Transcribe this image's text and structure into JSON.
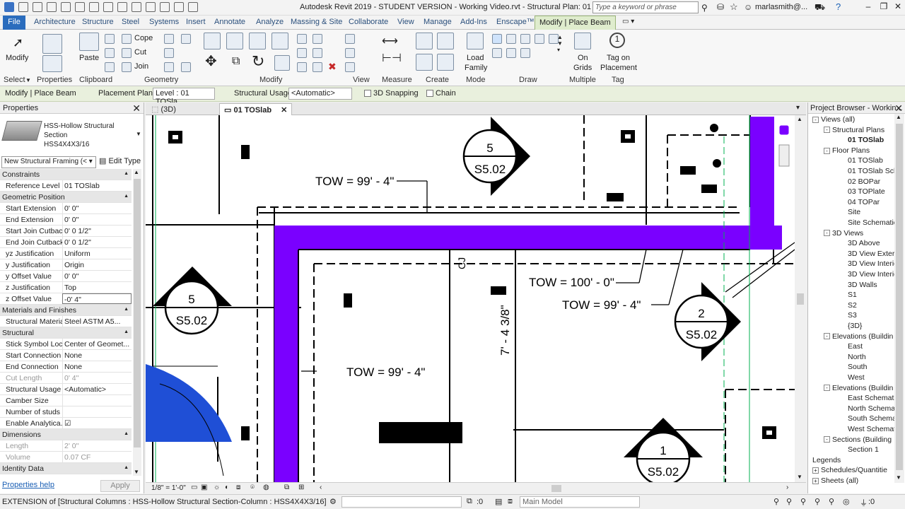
{
  "app": {
    "title": "Autodesk Revit 2019 - STUDENT VERSION - Working Video.rvt - Structural Plan: 01 TOSlab",
    "search_placeholder": "Type a keyword or phrase",
    "user": "marlasmith@..."
  },
  "tabs": [
    "File",
    "Architecture",
    "Structure",
    "Steel",
    "Systems",
    "Insert",
    "Annotate",
    "Analyze",
    "Massing & Site",
    "Collaborate",
    "View",
    "Manage",
    "Add-Ins",
    "Enscape™",
    "Modify | Place Beam"
  ],
  "ribbon": {
    "modify_label": "Modify",
    "paste_label": "Paste",
    "cope_label": "Cope",
    "cut_label": "Cut",
    "join_label": "Join",
    "load_family_l1": "Load",
    "load_family_l2": "Family",
    "on_grids_l1": "On",
    "on_grids_l2": "Grids",
    "tag_l1": "Tag on",
    "tag_l2": "Placement",
    "panels": [
      "Select",
      "Properties",
      "Clipboard",
      "Geometry",
      "Modify",
      "View",
      "Measure",
      "Create",
      "Mode",
      "Draw",
      "Multiple",
      "Tag"
    ]
  },
  "options": {
    "context": "Modify | Place Beam",
    "placement_plane_label": "Placement Plane:",
    "placement_plane_value": "Level : 01 TOSla",
    "structural_usage_label": "Structural Usage:",
    "structural_usage_value": "<Automatic>",
    "snapping": "3D Snapping",
    "chain": "Chain"
  },
  "properties": {
    "title": "Properties",
    "type_line1": "HSS-Hollow Structural",
    "type_line2": "Section",
    "type_line3": "HSS4X4X3/16",
    "filter": "New Structural Framing (<",
    "edit_type": "Edit Type",
    "rows": [
      {
        "k": "Constraints",
        "sec": true
      },
      {
        "k": "Reference Level",
        "v": "01 TOSlab"
      },
      {
        "k": "Geometric Position",
        "sec": true
      },
      {
        "k": "Start Extension",
        "v": "0'  0\""
      },
      {
        "k": "End Extension",
        "v": "0'  0\""
      },
      {
        "k": "Start Join Cutback",
        "v": "0'  0 1/2\""
      },
      {
        "k": "End Join Cutback",
        "v": "0'  0 1/2\""
      },
      {
        "k": "yz Justification",
        "v": "Uniform"
      },
      {
        "k": "y Justification",
        "v": "Origin"
      },
      {
        "k": "y Offset Value",
        "v": "0'  0\""
      },
      {
        "k": "z Justification",
        "v": "Top"
      },
      {
        "k": "z Offset Value",
        "v": "-0'  4\""
      },
      {
        "k": "Materials and Finishes",
        "sec": true
      },
      {
        "k": "Structural Material",
        "v": "Steel ASTM A5..."
      },
      {
        "k": "Structural",
        "sec": true
      },
      {
        "k": "Stick Symbol Loc...",
        "v": "Center of Geomet..."
      },
      {
        "k": "Start Connection",
        "v": "None"
      },
      {
        "k": "End Connection",
        "v": "None"
      },
      {
        "k": "Cut Length",
        "v": "0'  4\"",
        "dis": true
      },
      {
        "k": "Structural Usage",
        "v": "<Automatic>"
      },
      {
        "k": "Camber Size",
        "v": ""
      },
      {
        "k": "Number of studs",
        "v": ""
      },
      {
        "k": "Enable Analytica...",
        "v": "☑"
      },
      {
        "k": "Dimensions",
        "sec": true
      },
      {
        "k": "Length",
        "v": "2'  0\"",
        "dis": true
      },
      {
        "k": "Volume",
        "v": "0.07 CF",
        "dis": true
      },
      {
        "k": "Identity Data",
        "sec": true
      }
    ],
    "help": "Properties help",
    "apply": "Apply"
  },
  "view_tabs": [
    "(3D)",
    "01 TOSlab"
  ],
  "drawing": {
    "tow1": "TOW = 99' - 4\"",
    "tow2": "TOW = 100' - 0\"",
    "tow3": "TOW = 99' - 4\"",
    "tow4": "TOW = 99' - 4\"",
    "dim": "7' - 4 3/8\"",
    "cj": "CJ",
    "markers": [
      {
        "num": "5",
        "sheet": "S5.02"
      },
      {
        "num": "5",
        "sheet": "S5.02"
      },
      {
        "num": "2",
        "sheet": "S5.02"
      },
      {
        "num": "1",
        "sheet": "S5.02"
      }
    ],
    "beam_color": "#7a00ff"
  },
  "view_control": {
    "scale": "1/8\" = 1'-0\""
  },
  "project_browser": {
    "title": "Project Browser - Workin...",
    "items": [
      {
        "t": "Views (all)",
        "lvl": 0,
        "tog": "-"
      },
      {
        "t": "Structural Plans",
        "lvl": 1,
        "tog": "-"
      },
      {
        "t": "01 TOSlab",
        "lvl": 2,
        "bold": true
      },
      {
        "t": "Floor Plans",
        "lvl": 1,
        "tog": "-"
      },
      {
        "t": "01 TOSlab",
        "lvl": 2
      },
      {
        "t": "01 TOSlab Sch",
        "lvl": 2
      },
      {
        "t": "02 BOPar",
        "lvl": 2
      },
      {
        "t": "03 TOPlate",
        "lvl": 2
      },
      {
        "t": "04 TOPar",
        "lvl": 2
      },
      {
        "t": "Site",
        "lvl": 2
      },
      {
        "t": "Site Schematic",
        "lvl": 2
      },
      {
        "t": "3D Views",
        "lvl": 1,
        "tog": "-"
      },
      {
        "t": "3D Above",
        "lvl": 2
      },
      {
        "t": "3D View Exteri",
        "lvl": 2
      },
      {
        "t": "3D View Interic",
        "lvl": 2
      },
      {
        "t": "3D View Interic",
        "lvl": 2
      },
      {
        "t": "3D Walls",
        "lvl": 2
      },
      {
        "t": "S1",
        "lvl": 2
      },
      {
        "t": "S2",
        "lvl": 2
      },
      {
        "t": "S3",
        "lvl": 2
      },
      {
        "t": "{3D}",
        "lvl": 2
      },
      {
        "t": "Elevations (Buildin",
        "lvl": 1,
        "tog": "-"
      },
      {
        "t": "East",
        "lvl": 2
      },
      {
        "t": "North",
        "lvl": 2
      },
      {
        "t": "South",
        "lvl": 2
      },
      {
        "t": "West",
        "lvl": 2
      },
      {
        "t": "Elevations (Buildin",
        "lvl": 1,
        "tog": "-"
      },
      {
        "t": "East Schematic",
        "lvl": 2
      },
      {
        "t": "North Schemat",
        "lvl": 2
      },
      {
        "t": "South Schemat",
        "lvl": 2
      },
      {
        "t": "West Schemati",
        "lvl": 2
      },
      {
        "t": "Sections (Building",
        "lvl": 1,
        "tog": "-"
      },
      {
        "t": "Section 1",
        "lvl": 2
      },
      {
        "t": "Legends",
        "lvl": 0
      },
      {
        "t": "Schedules/Quantitie",
        "lvl": 0,
        "tog": "+"
      },
      {
        "t": "Sheets (all)",
        "lvl": 0,
        "tog": "+"
      }
    ]
  },
  "status": {
    "text": "EXTENSION  of [Structural Columns : HSS-Hollow Structural Section-Column : HSS4X4X3/16]",
    "filter_count": ":0",
    "model": "Main Model"
  }
}
